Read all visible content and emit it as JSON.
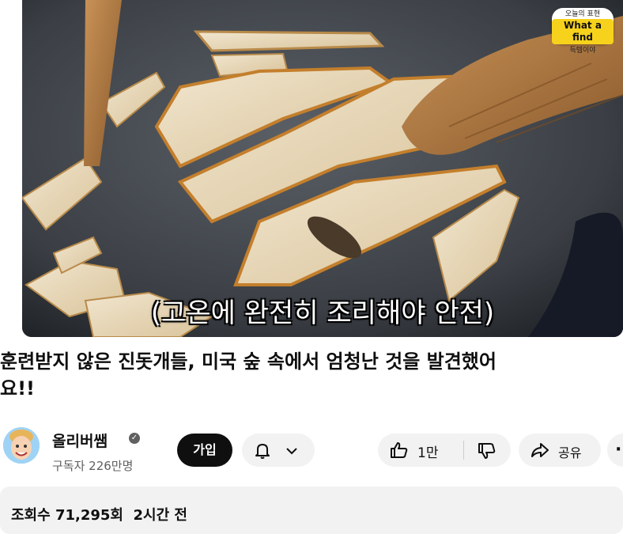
{
  "video": {
    "subtitle": "(고온에 완전히 조리해야 안전)",
    "badge": {
      "top": "오늘의 표현",
      "main": "What a find",
      "bottom": "득템이야"
    }
  },
  "title": "훈련받지 않은 진돗개들, 미국 숲 속에서 엄청난 것을 발견했어\n요!!",
  "channel": {
    "name": "올리버쌤",
    "verified_mark": "✓",
    "subscribers": "구독자 226만명"
  },
  "actions": {
    "join_label": "가입",
    "like_count": "1만",
    "share_label": "공유",
    "more_label": "·"
  },
  "description": {
    "views": "조회수 71,295회",
    "time": "2시간 전"
  },
  "icons": {
    "bell": "bell-icon",
    "chevron": "chevron-down-icon",
    "like": "thumbs-up-icon",
    "dislike": "thumbs-down-icon",
    "share": "share-icon"
  }
}
